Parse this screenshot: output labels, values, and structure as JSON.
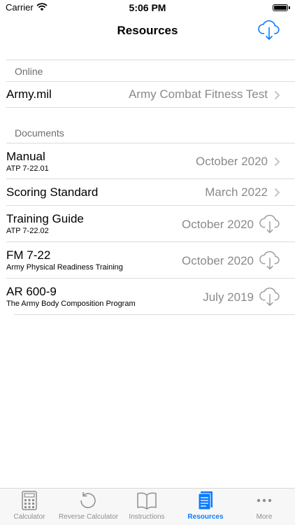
{
  "status_bar": {
    "carrier": "Carrier",
    "time": "5:06 PM"
  },
  "nav": {
    "title": "Resources",
    "download_icon": "cloud-download-icon"
  },
  "sections": {
    "online": {
      "header": "Online",
      "rows": [
        {
          "title": "Army.mil",
          "value": "Army Combat Fitness Test",
          "accessory": "chevron"
        }
      ]
    },
    "documents": {
      "header": "Documents",
      "rows": [
        {
          "title": "Manual",
          "subtitle": "ATP 7-22.01",
          "value": "October 2020",
          "accessory": "chevron"
        },
        {
          "title": "Scoring Standard",
          "value": "March 2022",
          "accessory": "chevron"
        },
        {
          "title": "Training Guide",
          "subtitle": "ATP 7-22.02",
          "value": "October 2020",
          "accessory": "cloud-download"
        },
        {
          "title": "FM 7-22",
          "subtitle": "Army Physical Readiness Training",
          "value": "October 2020",
          "accessory": "cloud-download"
        },
        {
          "title": "AR 600-9",
          "subtitle": "The Army Body Composition Program",
          "value": "July 2019",
          "accessory": "cloud-download"
        }
      ]
    }
  },
  "tabs": [
    {
      "label": "Calculator",
      "icon": "calculator-icon",
      "active": false
    },
    {
      "label": "Reverse Calculator",
      "icon": "rewind-arrow-icon",
      "active": false
    },
    {
      "label": "Instructions",
      "icon": "book-icon",
      "active": false
    },
    {
      "label": "Resources",
      "icon": "document-icon",
      "active": true
    },
    {
      "label": "More",
      "icon": "ellipsis-icon",
      "active": false
    }
  ],
  "colors": {
    "accent": "#0a7bff",
    "secondary_text": "#8a8a8e",
    "header_text": "#6d6d72",
    "inactive_tab": "#8e8e93"
  }
}
